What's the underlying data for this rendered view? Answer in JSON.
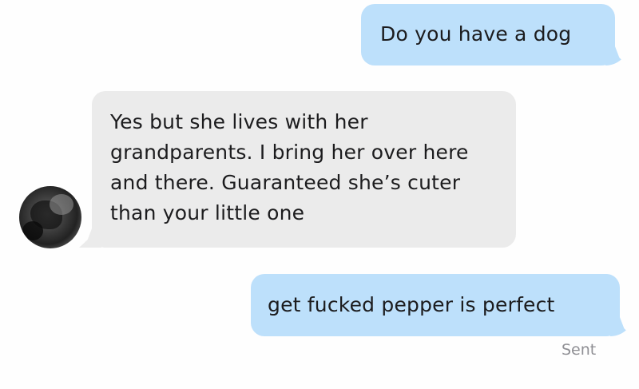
{
  "conversation": {
    "messages": [
      {
        "direction": "outgoing",
        "text": "Do you have a dog"
      },
      {
        "direction": "incoming",
        "lines": [
          "Yes but she lives with her",
          "grandparents. I bring her over here",
          "and there. Guaranteed she’s cuter",
          "than your little one"
        ]
      },
      {
        "direction": "outgoing",
        "text": "get fucked pepper is perfect"
      }
    ],
    "status": "Sent"
  },
  "colors": {
    "outgoing_bubble": "#bde0fb",
    "incoming_bubble": "#ebebeb",
    "status_text": "#8f8f94"
  }
}
